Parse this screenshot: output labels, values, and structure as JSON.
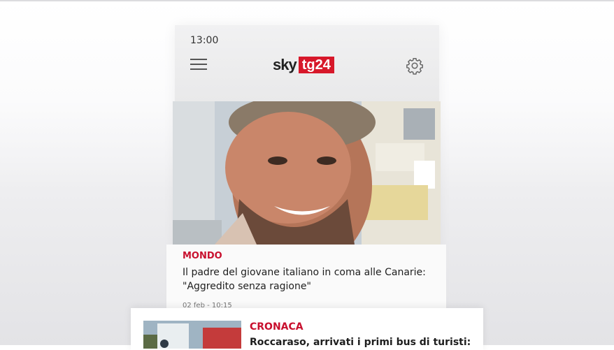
{
  "status": {
    "time": "13:00"
  },
  "header": {
    "logo_sky": "sky",
    "logo_tg": "tg24",
    "menu_icon": "hamburger-icon",
    "settings_icon": "gear-icon"
  },
  "main_card": {
    "category": "MONDO",
    "title": "Il padre del giovane italiano in coma alle Canarie: \"Aggredito senza ragione\"",
    "date": "02 feb - 10:15"
  },
  "second_card": {
    "category": "CRONACA",
    "title": "Roccaraso, arrivati i primi bus di turisti:"
  },
  "colors": {
    "accent": "#c8102e",
    "logo_red": "#d7182a"
  }
}
